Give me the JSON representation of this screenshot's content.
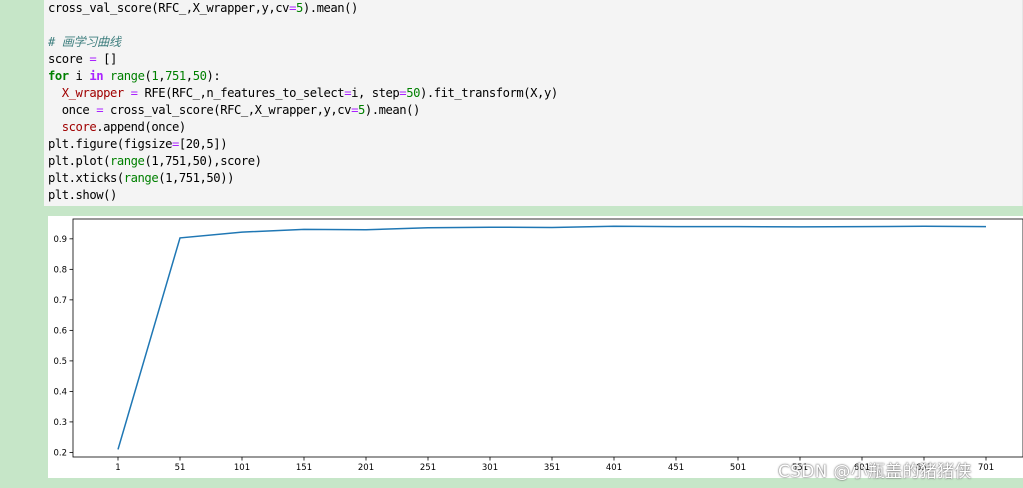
{
  "code_cell": {
    "lines": [
      [
        {
          "t": "cross_val_score(RFC_,X_wrapper,y,cv"
        },
        {
          "t": "=",
          "c": "o"
        },
        {
          "t": "5",
          "c": "n"
        },
        {
          "t": ").mean()"
        }
      ],
      [],
      [
        {
          "t": "# 画学习曲线",
          "c": "c"
        }
      ],
      [
        {
          "t": "score "
        },
        {
          "t": "=",
          "c": "o"
        },
        {
          "t": " []"
        }
      ],
      [
        {
          "t": "for",
          "c": "k"
        },
        {
          "t": " i "
        },
        {
          "t": "in",
          "c": "ow"
        },
        {
          "t": " "
        },
        {
          "t": "range",
          "c": "b"
        },
        {
          "t": "("
        },
        {
          "t": "1",
          "c": "n"
        },
        {
          "t": ","
        },
        {
          "t": "751",
          "c": "n"
        },
        {
          "t": ","
        },
        {
          "t": "50",
          "c": "n"
        },
        {
          "t": "):"
        }
      ],
      [
        {
          "t": "  "
        },
        {
          "t": "X_wrapper",
          "c": "v"
        },
        {
          "t": " "
        },
        {
          "t": "=",
          "c": "o"
        },
        {
          "t": " RFE(RFC_,n_features_to_select"
        },
        {
          "t": "=",
          "c": "o"
        },
        {
          "t": "i, step"
        },
        {
          "t": "=",
          "c": "o"
        },
        {
          "t": "50",
          "c": "n"
        },
        {
          "t": ").fit_transform(X,y)"
        }
      ],
      [
        {
          "t": "  once "
        },
        {
          "t": "=",
          "c": "o"
        },
        {
          "t": " cross_val_score(RFC_,X_wrapper,y,cv"
        },
        {
          "t": "=",
          "c": "o"
        },
        {
          "t": "5",
          "c": "n"
        },
        {
          "t": ").mean()"
        }
      ],
      [
        {
          "t": "  "
        },
        {
          "t": "score",
          "c": "v"
        },
        {
          "t": ".append(once)"
        }
      ],
      [
        {
          "t": "plt.figure(figsize"
        },
        {
          "t": "=",
          "c": "o"
        },
        {
          "t": "[20,5])"
        }
      ],
      [
        {
          "t": "plt.plot("
        },
        {
          "t": "range",
          "c": "b"
        },
        {
          "t": "(1,751,50),score)"
        }
      ],
      [
        {
          "t": "plt.xticks("
        },
        {
          "t": "range",
          "c": "b"
        },
        {
          "t": "(1,751,50))"
        }
      ],
      [
        {
          "t": "plt.show()"
        }
      ]
    ]
  },
  "chart_data": {
    "type": "line",
    "title": "",
    "xlabel": "",
    "ylabel": "",
    "x": [
      1,
      51,
      101,
      151,
      201,
      251,
      301,
      351,
      401,
      451,
      501,
      551,
      601,
      651,
      701
    ],
    "series": [
      {
        "values": [
          0.21,
          0.903,
          0.922,
          0.931,
          0.93,
          0.936,
          0.938,
          0.937,
          0.941,
          0.94,
          0.94,
          0.939,
          0.94,
          0.941,
          0.94
        ],
        "color": "#1f77b4"
      }
    ],
    "xticks": [
      "1",
      "51",
      "101",
      "151",
      "201",
      "251",
      "301",
      "351",
      "401",
      "451",
      "501",
      "551",
      "601",
      "651",
      "701"
    ],
    "yticks": [
      "0.2",
      "0.3",
      "0.4",
      "0.5",
      "0.6",
      "0.7",
      "0.8",
      "0.9"
    ],
    "ylim": [
      0.185,
      0.965
    ],
    "grid": false
  },
  "watermark": "CSDN @小瓶盖的猪猪侠"
}
